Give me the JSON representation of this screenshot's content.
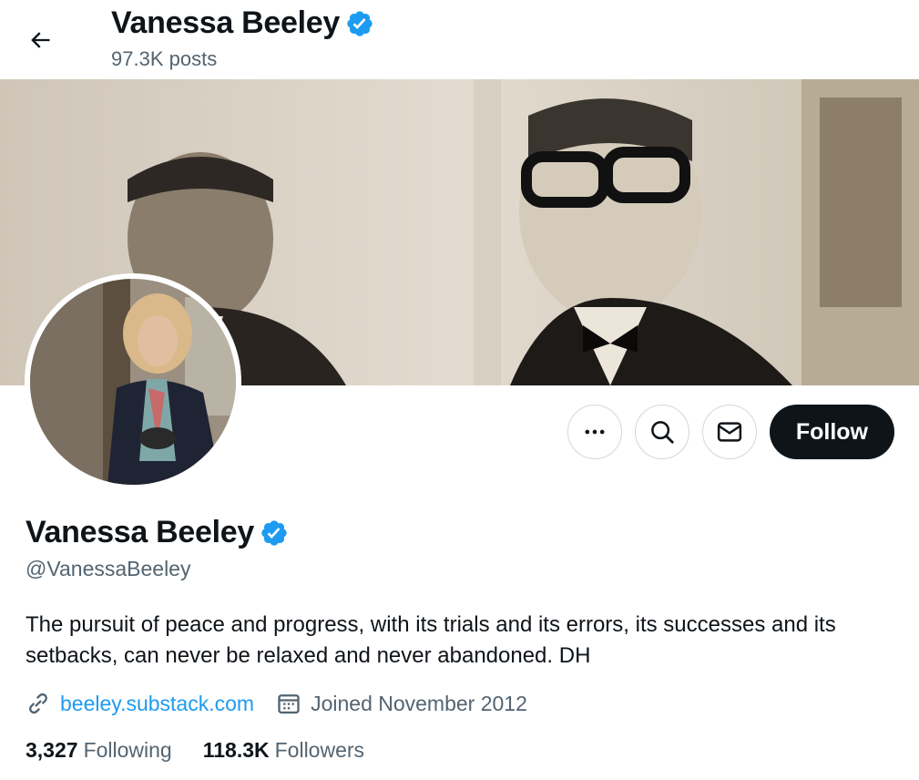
{
  "header": {
    "name": "Vanessa Beeley",
    "posts_count": "97.3K posts"
  },
  "profile": {
    "name": "Vanessa Beeley",
    "handle": "@VanessaBeeley",
    "bio": "The pursuit of peace and progress, with its trials and its errors, its successes and its setbacks, can never be relaxed and never abandoned. DH",
    "website": "beeley.substack.com",
    "joined": "Joined November 2012",
    "following_count": "3,327",
    "following_label": "Following",
    "followers_count": "118.3K",
    "followers_label": "Followers"
  },
  "actions": {
    "follow_label": "Follow"
  },
  "icons": {
    "back": "arrow-left-icon",
    "verified": "verified-badge-icon",
    "more": "more-icon",
    "search": "search-icon",
    "message": "envelope-icon",
    "link": "link-icon",
    "calendar": "calendar-icon"
  },
  "colors": {
    "accent": "#1d9bf0",
    "text_primary": "#0f1419",
    "text_secondary": "#536471",
    "follow_button": "#0f1419",
    "border": "#cfd9de"
  }
}
